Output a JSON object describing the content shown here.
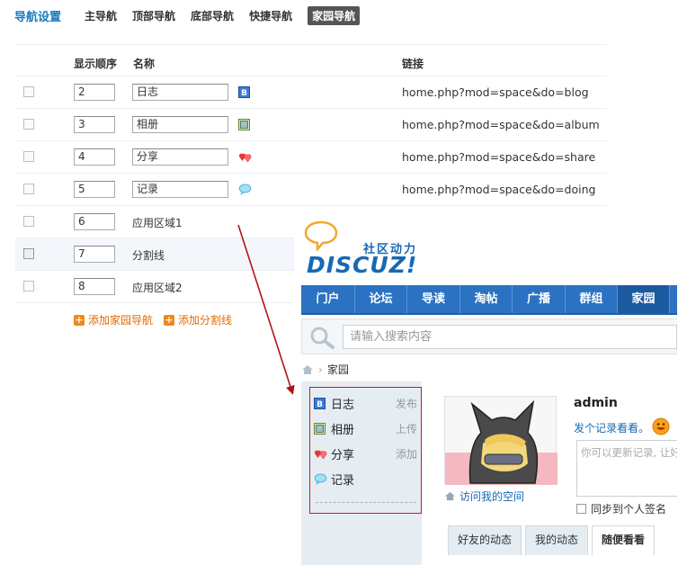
{
  "topnav": {
    "title": "导航设置",
    "tabs": [
      {
        "label": "主导航"
      },
      {
        "label": "顶部导航"
      },
      {
        "label": "底部导航"
      },
      {
        "label": "快捷导航"
      },
      {
        "label": "家园导航",
        "active": true
      }
    ]
  },
  "table": {
    "headers": {
      "order": "显示顺序",
      "name": "名称",
      "link": "链接"
    },
    "rows": [
      {
        "order": "2",
        "name": "日志",
        "icon": "blog-icon",
        "link": "home.php?mod=space&do=blog"
      },
      {
        "order": "3",
        "name": "相册",
        "icon": "album-icon",
        "link": "home.php?mod=space&do=album"
      },
      {
        "order": "4",
        "name": "分享",
        "icon": "share-icon",
        "link": "home.php?mod=space&do=share"
      },
      {
        "order": "5",
        "name": "记录",
        "icon": "doing-icon",
        "link": "home.php?mod=space&do=doing"
      },
      {
        "order": "6",
        "name": "应用区域1"
      },
      {
        "order": "7",
        "name": "分割线"
      },
      {
        "order": "8",
        "name": "应用区域2"
      }
    ]
  },
  "add_links": {
    "add_nav": "添加家园导航",
    "add_divider": "添加分割线"
  },
  "preview": {
    "slogan": "社区动力",
    "logo": "DISCUZ!",
    "nav": [
      "门户",
      "论坛",
      "导读",
      "淘帖",
      "广播",
      "群组",
      "家园"
    ],
    "nav_active": "家园",
    "search_placeholder": "请输入搜索内容",
    "breadcrumb": "家园",
    "sidebar": [
      {
        "label": "日志",
        "action": "发布",
        "icon": "blog-icon"
      },
      {
        "label": "相册",
        "action": "上传",
        "icon": "album-icon"
      },
      {
        "label": "分享",
        "action": "添加",
        "icon": "share-icon"
      },
      {
        "label": "记录",
        "action": "",
        "icon": "doing-icon"
      }
    ],
    "username": "admin",
    "doing_prompt": "发个记录看看。",
    "status_placeholder": "你可以更新记录, 让好友们知道你在做什么...",
    "visit_space": "访问我的空间",
    "sync_signature": "同步到个人签名",
    "feed_tabs": [
      "好友的动态",
      "我的动态",
      "随便看看"
    ],
    "feed_active": "随便看看"
  },
  "colors": {
    "accent": "#1a7bbf",
    "nav_bg": "#2b72c2",
    "highlight_border": "#d9131c",
    "arrow": "#b0141a"
  }
}
